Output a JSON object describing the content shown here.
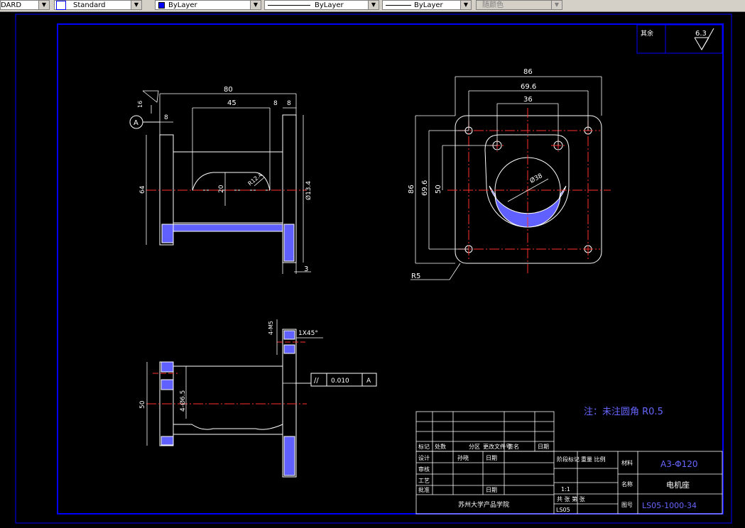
{
  "toolbar": {
    "dimstyle": "DARD",
    "textstyle": "Standard",
    "layer_color": "ByLayer",
    "linetype": "ByLayer",
    "lineweight": "ByLayer",
    "plotstyle": "随颜色"
  },
  "drawing": {
    "dims": {
      "d80": "80",
      "d45": "45",
      "d8a": "8",
      "d8b": "8",
      "d8c": "8",
      "d16": "16",
      "d64": "64",
      "d20": "20",
      "r124": "R12.4",
      "d134": "Ø13.4",
      "d3": "3",
      "d86t": "86",
      "d696t": "69.6",
      "d36": "36",
      "d86l": "86",
      "d696l": "69.6",
      "d50l": "50",
      "d38": "Ø38",
      "r5": "R5",
      "d4m5": "4-M5",
      "chamfer": "1X45°",
      "d4phi": "4-Ø6.5",
      "d50b": "50"
    },
    "datum": "A",
    "tolerance": {
      "symbol": "//",
      "value": "0.010",
      "datum": "A"
    },
    "surface": {
      "label": "其余",
      "roughness": "6.3"
    },
    "note": "注：未注圆角 R0.5",
    "title_block": {
      "material": "A3-Φ120",
      "part_name": "电机座",
      "drawing_no": "LS05-1000-34",
      "company": "苏州大学产品学院",
      "scale_label": "比例",
      "weight_label": "重量",
      "mat_label": "材料",
      "name_label": "名称",
      "no_label": "图号",
      "scale_val": "1:1",
      "sheet": "LS05",
      "r1": [
        "标记",
        "处数",
        "分区",
        "更改文件号",
        "签名",
        "日期"
      ],
      "r2": [
        "设计",
        "孙晓",
        "日期"
      ],
      "r3": [
        "审核"
      ],
      "r4": [
        "工艺"
      ],
      "r5": [
        "批准",
        "日期"
      ],
      "mid1": "阶段标记",
      "mid2": "重量 比例",
      "mid3": "共 张 第 张"
    }
  }
}
